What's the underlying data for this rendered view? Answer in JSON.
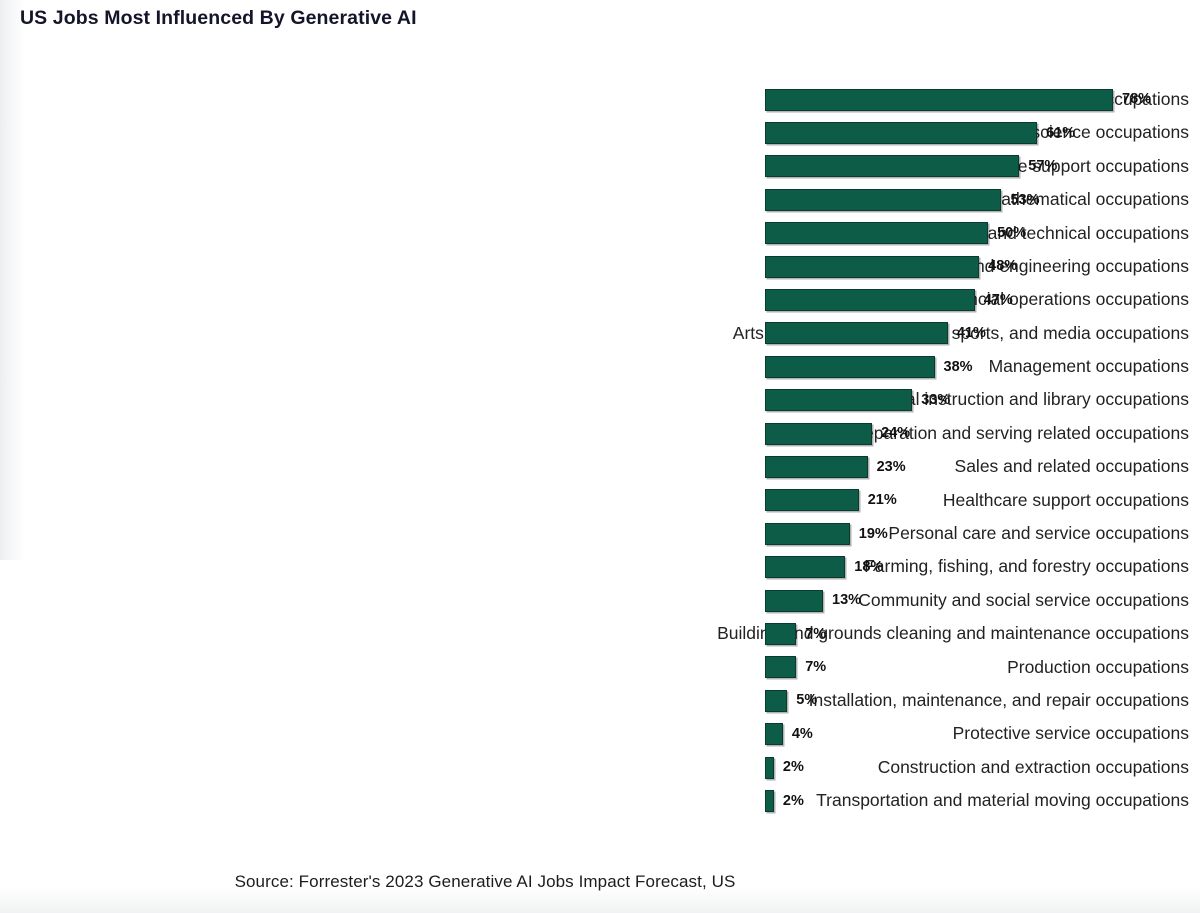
{
  "title": "US Jobs Most Influenced By Generative AI",
  "source": "Source: Forrester's 2023 Generative AI Jobs Impact Forecast, US",
  "colors": {
    "bar_fill": "#0d5c47",
    "bar_outline": "#0a3b2e",
    "title_text": "#14142b",
    "label_text": "#222222",
    "value_text": "#111111",
    "background": "#ffffff"
  },
  "chart_data": {
    "type": "bar",
    "orientation": "horizontal",
    "title": "US Jobs Most Influenced By Generative AI",
    "subtitle": "",
    "xlabel": "",
    "ylabel": "",
    "xlim": [
      0,
      78
    ],
    "grid": false,
    "legend": "none",
    "value_suffix": "%",
    "sorted": "descending",
    "categories": [
      "Legal occupations",
      "Life, physical, and social science occupations",
      "Office and administrative support occupations",
      "Computer and mathematical occupations",
      "Healthcare practitioners and technical occupations",
      "Architecture and engineering occupations",
      "Business and financial operations occupations",
      "Arts, design, entertainment, sports, and media occupations",
      "Management occupations",
      "Educational instruction and library occupations",
      "Food preparation and serving related occupations",
      "Sales and related occupations",
      "Healthcare support occupations",
      "Personal care and service occupations",
      "Farming, fishing, and forestry occupations",
      "Community and social service occupations",
      "Building and grounds cleaning and maintenance occupations",
      "Production occupations",
      "Installation, maintenance, and repair occupations",
      "Protective service occupations",
      "Construction and extraction occupations",
      "Transportation and material moving occupations"
    ],
    "values": [
      78,
      61,
      57,
      53,
      50,
      48,
      47,
      41,
      38,
      33,
      24,
      23,
      21,
      19,
      18,
      13,
      7,
      7,
      5,
      4,
      2,
      2
    ],
    "value_labels": [
      "78%",
      "61%",
      "57%",
      "53%",
      "50%",
      "48%",
      "47%",
      "41%",
      "38%",
      "33%",
      "24%",
      "23%",
      "21%",
      "19%",
      "18%",
      "13%",
      "7%",
      "7%",
      "5%",
      "4%",
      "2%",
      "2%"
    ]
  }
}
